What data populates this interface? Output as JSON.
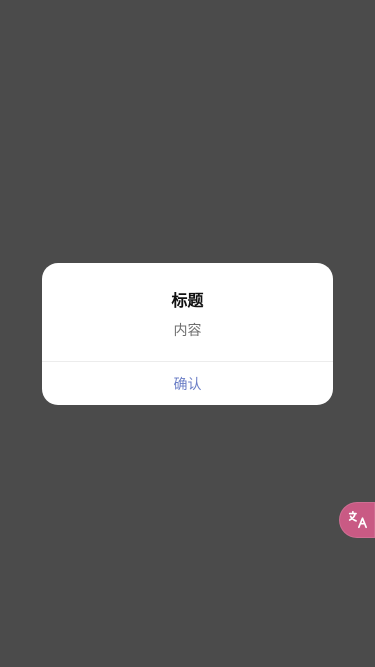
{
  "dialog": {
    "title": "标题",
    "content": "内容",
    "confirm_label": "确认"
  },
  "floating_action": {
    "icon": "translate-icon",
    "color": "#c95a84"
  }
}
